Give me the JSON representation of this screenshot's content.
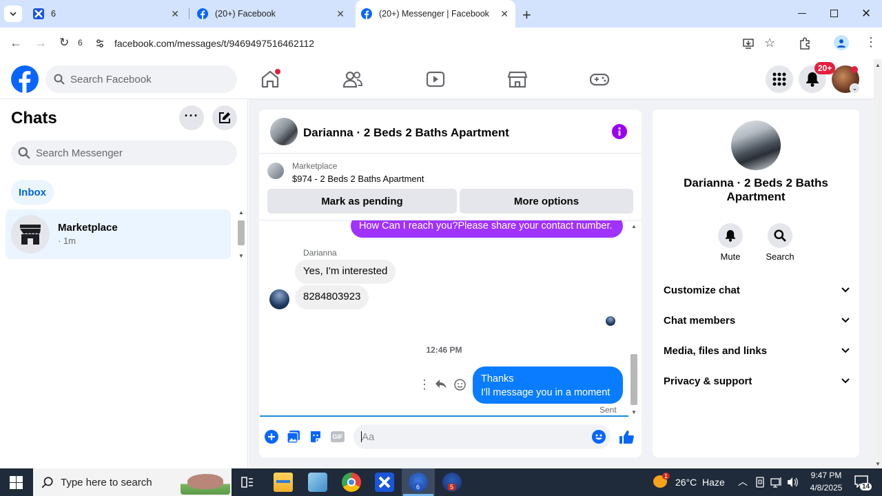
{
  "browser": {
    "tabs": [
      {
        "title": "6"
      },
      {
        "title": "(20+) Facebook"
      },
      {
        "title": "(20+) Messenger | Facebook"
      }
    ],
    "url": "facebook.com/messages/t/9469497516462112",
    "reload_count": "6"
  },
  "fb": {
    "search_placeholder": "Search Facebook",
    "notif_badge": "20+"
  },
  "left": {
    "title": "Chats",
    "search_placeholder": "Search Messenger",
    "inbox_label": "Inbox",
    "chat_item": {
      "name": "Marketplace",
      "time": "· 1m"
    }
  },
  "chat": {
    "header_title": "Darianna · 2 Beds 2 Baths Apartment",
    "marketplace_label": "Marketplace",
    "listing": "$974 - 2 Beds 2 Baths Apartment",
    "btn_pending": "Mark as pending",
    "btn_more": "More options",
    "msg_out_top": "How Can I reach you?Please share your contact number.",
    "sender_name": "Darianna",
    "msg_in_1": "Yes, I'm interested",
    "msg_in_2": "8284803923",
    "timestamp": "12:46 PM",
    "msg_out_1": "Thanks",
    "msg_out_2": "I'll message you in a moment",
    "sent_label": "Sent",
    "composer_placeholder": "Aa"
  },
  "info": {
    "name": "Darianna · 2 Beds 2 Baths Apartment",
    "mute_label": "Mute",
    "search_label": "Search",
    "menu": [
      "Customize chat",
      "Chat members",
      "Media, files and links",
      "Privacy & support"
    ]
  },
  "taskbar": {
    "search_placeholder": "Type here to search",
    "weather": "26°C  Haze",
    "time": "9:47 PM",
    "date": "4/8/2025",
    "notif_count": "14",
    "weather_badge": "1",
    "app_badge_1": "6",
    "app_badge_2": "5"
  },
  "colors": {
    "fb_blue": "#0866ff",
    "messenger_purple": "#a033ff",
    "outgoing_blue": "#0a7cff",
    "accent_violet": "#9b00f0"
  }
}
